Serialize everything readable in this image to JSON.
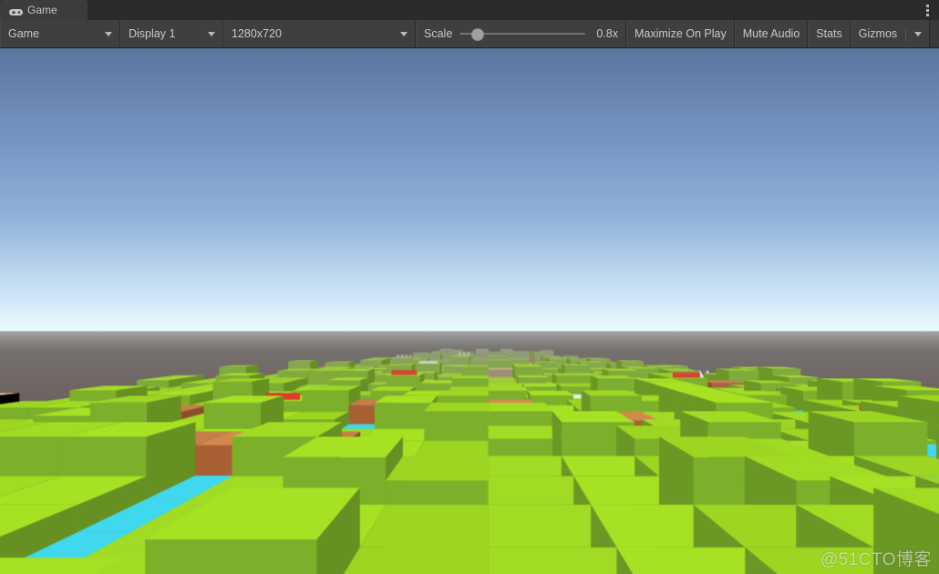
{
  "window": {
    "title": "Game",
    "tab_icon": "gamepad-icon",
    "menu_icon": "kebab-menu-icon"
  },
  "toolbar": {
    "game_dropdown": "Game",
    "display_dropdown": "Display 1",
    "resolution_dropdown": "1280x720",
    "scale_label": "Scale",
    "scale_value": "0.8x",
    "scale_fraction": 0.105,
    "maximize_on_play": "Maximize On Play",
    "mute_audio": "Mute Audio",
    "stats": "Stats",
    "gizmos": "Gizmos",
    "gizmos_caret_icon": "chevron-down-icon"
  },
  "gameview": {
    "watermark": "@51CTO博客",
    "resolution_label": "1280x720",
    "horizon_y": 0.545,
    "colors": {
      "sky_top": "#5b769f",
      "sky_mid": "#8fb1d8",
      "sky_horizon": "#e8fbff",
      "ground": "#6d625f",
      "grass_top": "#a5e024",
      "grass_side": "#7cb02a",
      "water_top": "#3fd8ee",
      "water_side": "#57c5cf",
      "water_deep": "#2a7f94",
      "bridge_top": "#d4864e",
      "bridge_side": "#a85f32",
      "sand_top": "#e0b894",
      "red_accent": "#e03c2a",
      "snow": "#f2f7fa",
      "snow_shade": "#b9c7d0"
    }
  },
  "scene": {
    "description": "Low-poly voxel island terrain with grass tiles, water channels, wooden bridges and white mountain peaks",
    "tiles_visible": 140,
    "camera_pitch_deg": -12
  }
}
